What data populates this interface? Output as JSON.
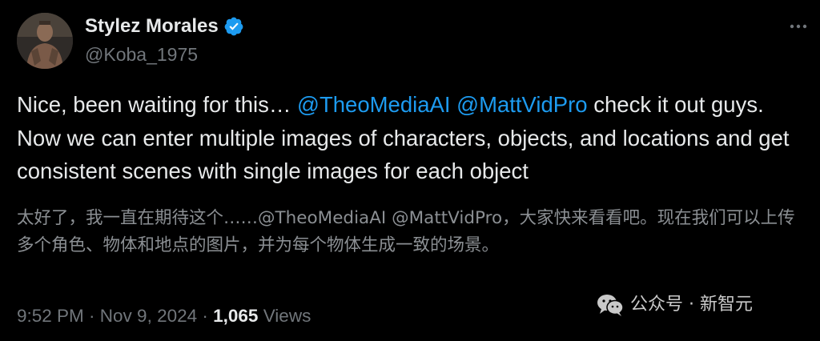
{
  "author": {
    "display_name": "Stylez Morales",
    "handle": "@Koba_1975",
    "verified": true,
    "verified_color": "#1d9bf0"
  },
  "more_icon": "more-horizontal-icon",
  "tweet": {
    "intro": "Nice, been waiting for this… ",
    "mention_1": "@TheoMediaAI",
    "mention_2": "@MattVidPro",
    "body": " check it out guys. Now we can enter multiple images of characters, objects, and locations and get consistent scenes with single images for each object",
    "translation": "太好了，我一直在期待这个……@TheoMediaAI @MattVidPro，大家快来看看吧。现在我们可以上传多个角色、物体和地点的图片，并为每个物体生成一致的场景。"
  },
  "meta": {
    "time": "9:52 PM",
    "separator": " · ",
    "date": "Nov 9, 2024",
    "separator_2": " · ",
    "views_count": "1,065",
    "views_label": " Views"
  },
  "watermark": {
    "text": "公众号 · 新智元",
    "icon": "wechat-icon"
  },
  "colors": {
    "background": "#000000",
    "text": "#e7e9ea",
    "secondary": "#71767b",
    "link": "#1d9bf0"
  }
}
